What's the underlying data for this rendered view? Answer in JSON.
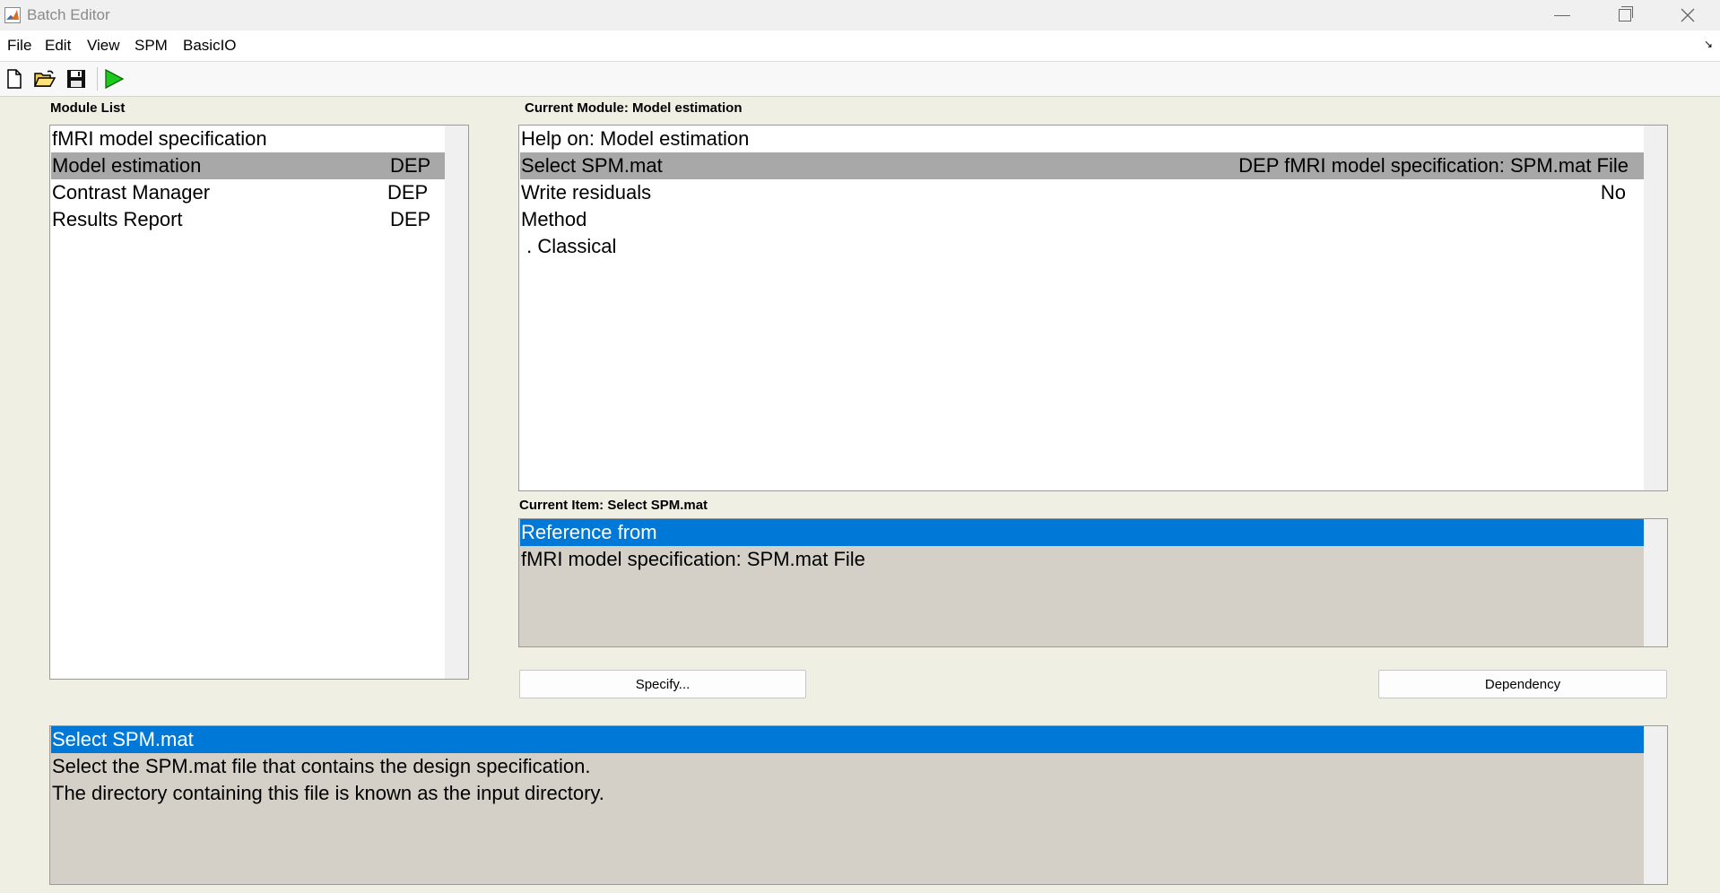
{
  "window": {
    "title": "Batch Editor"
  },
  "menu": [
    {
      "label": "File"
    },
    {
      "label": "Edit"
    },
    {
      "label": "View"
    },
    {
      "label": "SPM"
    },
    {
      "label": "BasicIO"
    }
  ],
  "toolbar": {
    "buttons": [
      {
        "icon": "new-file-icon"
      },
      {
        "icon": "open-folder-icon"
      },
      {
        "icon": "save-disk-icon"
      },
      {
        "icon": "run-play-icon"
      }
    ],
    "run_color": "#1ec81e"
  },
  "module_list": {
    "label": "Module List",
    "items": [
      {
        "name": "fMRI model specification",
        "status": ""
      },
      {
        "name": "Model estimation",
        "status": "DEP"
      },
      {
        "name": "Contrast Manager",
        "status": "DEP"
      },
      {
        "name": "Results Report",
        "status": "DEP"
      }
    ],
    "selected_index": 1
  },
  "current_module": {
    "label": "Current Module: Model estimation",
    "items": [
      {
        "name": "Help on: Model estimation",
        "value": ""
      },
      {
        "name": "Select SPM.mat",
        "value": "DEP fMRI model specification: SPM.mat File"
      },
      {
        "name": "Write residuals",
        "value": "No"
      },
      {
        "name": "Method",
        "value": ""
      },
      {
        "name": " . Classical",
        "value": ""
      }
    ],
    "selected_index": 1
  },
  "current_item": {
    "label": "Current Item: Select SPM.mat",
    "lines": [
      "Reference from",
      "fMRI model specification: SPM.mat File"
    ],
    "selected_index": 0
  },
  "buttons": {
    "specify": "Specify...",
    "dependency": "Dependency"
  },
  "help": {
    "lines": [
      "Select SPM.mat",
      "Select the SPM.mat file that contains the design specification.",
      "The directory containing this file is known as the input directory."
    ],
    "selected_index": 0
  },
  "colors": {
    "selection_blue": "#0078d7",
    "selection_gray": "#a8a8a8",
    "panel_background": "#efefe4",
    "readonly_background": "#d4d0c8"
  }
}
